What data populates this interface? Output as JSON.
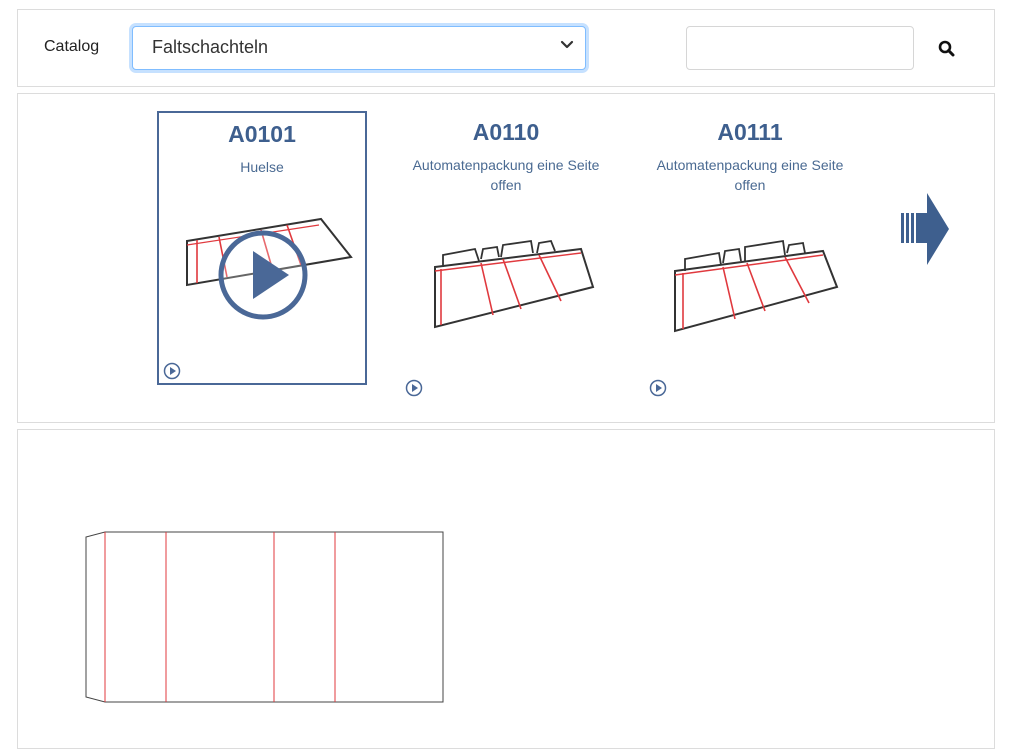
{
  "header": {
    "catalog_label": "Catalog",
    "catalog_selected": "Faltschachteln",
    "search_value": ""
  },
  "carousel": {
    "items": [
      {
        "code": "A0101",
        "description": "Huelse",
        "selected": true
      },
      {
        "code": "A0110",
        "description": "Automatenpackung eine Seite offen",
        "selected": false
      },
      {
        "code": "A0111",
        "description": "Automatenpackung eine Seite offen",
        "selected": false
      }
    ],
    "next_icon": "arrow-right-icon",
    "play_icon": "play-circle-icon"
  },
  "colors": {
    "accent": "#3e5f8e",
    "focus_border": "#80bdff",
    "cut_line": "#333333",
    "fold_line": "#e0393e"
  }
}
